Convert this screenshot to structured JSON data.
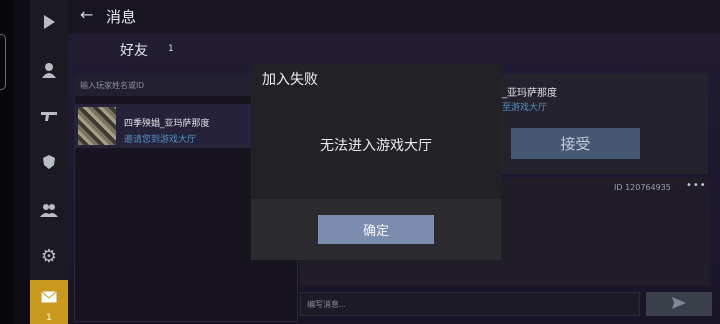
{
  "header": {
    "title": "消息",
    "back_icon": "back-arrow-icon"
  },
  "friends_tab": {
    "label": "好友",
    "count": "1"
  },
  "rail": {
    "items": [
      {
        "icon": "play-icon"
      },
      {
        "icon": "user-icon"
      },
      {
        "icon": "gun-icon"
      },
      {
        "icon": "emblem-icon"
      },
      {
        "icon": "group-icon"
      },
      {
        "icon": "gear-icon"
      },
      {
        "icon": "mail-icon",
        "count": "1",
        "active": true
      }
    ]
  },
  "search": {
    "placeholder": "输入玩家姓名或ID"
  },
  "friend_list": [
    {
      "name": "四季殃娼_亚玛萨那度",
      "subtitle": "邀请您到游戏大厅"
    }
  ],
  "detail": {
    "name": "_亚玛萨那度",
    "subtitle": "至游戏大厅",
    "accept_label": "接受",
    "id_text": "ID 120764935",
    "more_label": "•••"
  },
  "chat": {
    "placeholder": "编写消息..."
  },
  "modal": {
    "title": "加入失败",
    "message": "无法进入游戏大厅",
    "confirm_label": "确定"
  },
  "colors": {
    "accent_active": "#c99a1d",
    "confirm_button": "#7b8daf",
    "accept_button": "#445873",
    "link_blue": "#4f93c4"
  }
}
